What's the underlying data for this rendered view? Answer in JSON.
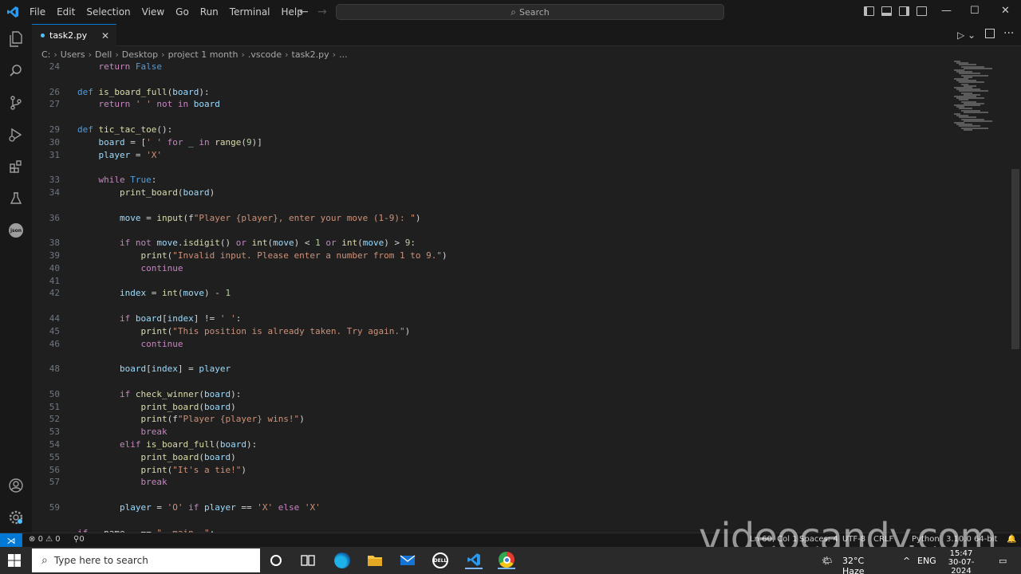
{
  "titlebar": {
    "menu": [
      "File",
      "Edit",
      "Selection",
      "View",
      "Go",
      "Run",
      "Terminal",
      "Help"
    ],
    "search_placeholder": "Search"
  },
  "tab": {
    "label": "task2.py"
  },
  "breadcrumb": [
    "C:",
    "Users",
    "Dell",
    "Desktop",
    "project 1 month",
    ".vscode",
    "task2.py",
    "..."
  ],
  "code_lines": [
    {
      "n": "24",
      "t": "    return False"
    },
    {
      "n": "",
      "t": ""
    },
    {
      "n": "26",
      "t": "def is_board_full(board):"
    },
    {
      "n": "27",
      "t": "    return ' ' not in board"
    },
    {
      "n": "",
      "t": ""
    },
    {
      "n": "29",
      "t": "def tic_tac_toe():"
    },
    {
      "n": "30",
      "t": "    board = [' ' for _ in range(9)]"
    },
    {
      "n": "31",
      "t": "    player = 'X'"
    },
    {
      "n": "",
      "t": ""
    },
    {
      "n": "33",
      "t": "    while True:"
    },
    {
      "n": "34",
      "t": "        print_board(board)"
    },
    {
      "n": "",
      "t": ""
    },
    {
      "n": "36",
      "t": "        move = input(f\"Player {player}, enter your move (1-9): \")"
    },
    {
      "n": "",
      "t": ""
    },
    {
      "n": "38",
      "t": "        if not move.isdigit() or int(move) < 1 or int(move) > 9:"
    },
    {
      "n": "39",
      "t": "            print(\"Invalid input. Please enter a number from 1 to 9.\")"
    },
    {
      "n": "40",
      "t": "            continue"
    },
    {
      "n": "41",
      "t": ""
    },
    {
      "n": "42",
      "t": "        index = int(move) - 1"
    },
    {
      "n": "",
      "t": ""
    },
    {
      "n": "44",
      "t": "        if board[index] != ' ':"
    },
    {
      "n": "45",
      "t": "            print(\"This position is already taken. Try again.\")"
    },
    {
      "n": "46",
      "t": "            continue"
    },
    {
      "n": "",
      "t": ""
    },
    {
      "n": "48",
      "t": "        board[index] = player"
    },
    {
      "n": "",
      "t": ""
    },
    {
      "n": "50",
      "t": "        if check_winner(board):"
    },
    {
      "n": "51",
      "t": "            print_board(board)"
    },
    {
      "n": "52",
      "t": "            print(f\"Player {player} wins!\")"
    },
    {
      "n": "53",
      "t": "            break"
    },
    {
      "n": "54",
      "t": "        elif is_board_full(board):"
    },
    {
      "n": "55",
      "t": "            print_board(board)"
    },
    {
      "n": "56",
      "t": "            print(\"It's a tie!\")"
    },
    {
      "n": "57",
      "t": "            break"
    },
    {
      "n": "",
      "t": ""
    },
    {
      "n": "59",
      "t": "        player = 'O' if player == 'X' else 'X'"
    },
    {
      "n": "",
      "t": ""
    },
    {
      "n": "",
      "t": "if __name__ == \"__main__\":"
    }
  ],
  "statusbar": {
    "errors": "0",
    "warnings": "0",
    "ports": "0",
    "position": "Ln 60, Col 1",
    "spaces": "Spaces: 4",
    "encoding": "UTF-8",
    "eol": "CRLF",
    "language": "Python",
    "interpreter": "3.10.0 64-bit"
  },
  "watermark": "videocandy.com",
  "taskbar": {
    "search_placeholder": "Type here to search",
    "weather": "32°C  Haze",
    "lang": "ENG",
    "time": "15:47",
    "date": "30-07-2024"
  }
}
